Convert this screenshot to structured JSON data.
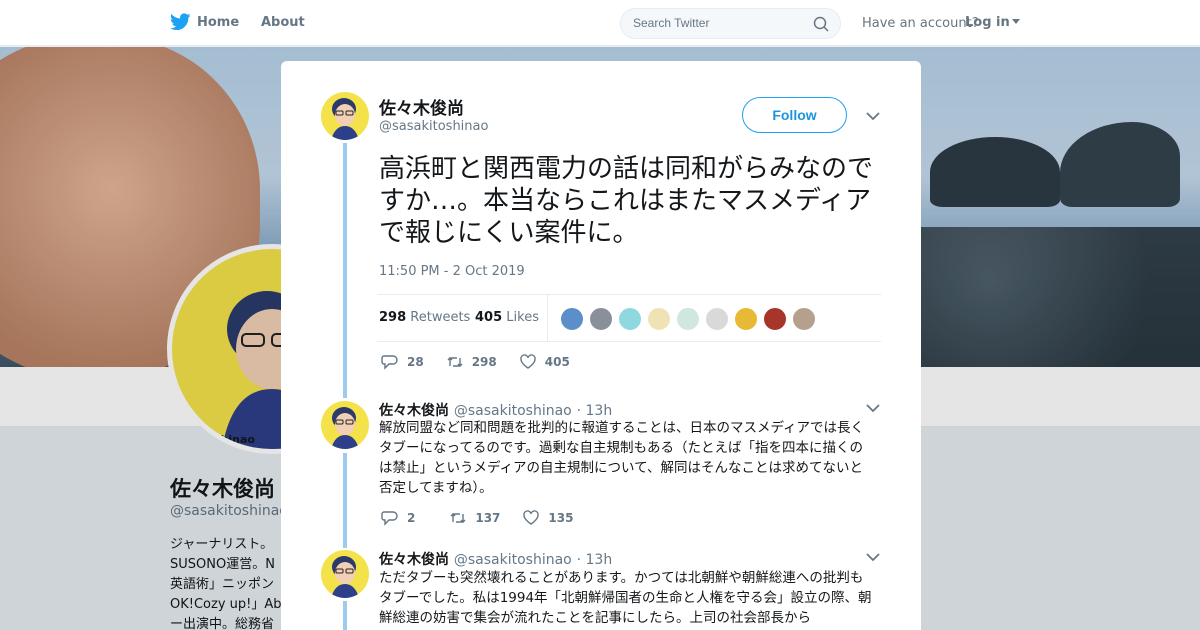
{
  "nav": {
    "home": "Home",
    "about": "About",
    "search_placeholder": "Search Twitter",
    "have_account": "Have an account?",
    "login": "Log in"
  },
  "profile": {
    "name": "佐々木俊尚",
    "handle": "@sasakitoshinao",
    "avatar_handle_overlay": "shinao",
    "bio_lines": [
      "ジャーナリスト。",
      "SUSONO運営。N",
      "英語術」ニッポン",
      "OK!Cozy up!」Ab",
      "ー出演中。総務省"
    ]
  },
  "tweet": {
    "name": "佐々木俊尚",
    "handle": "@sasakitoshinao",
    "follow": "Follow",
    "text": "高浜町と関西電力の話は同和がらみなのですか…。本当ならこれはまたマスメディアで報じにくい案件に。",
    "timestamp": "11:50 PM - 2 Oct 2019",
    "retweets_count": "298",
    "retweets_label": "Retweets",
    "likes_count": "405",
    "likes_label": "Likes",
    "replies": "28",
    "rts": "298",
    "likes": "405"
  },
  "replies": [
    {
      "name": "佐々木俊尚",
      "handle": "@sasakitoshinao",
      "time": "· 13h",
      "text": "解放同盟など同和問題を批判的に報道することは、日本のマスメディアでは長くタブーになってるのです。過剰な自主規制もある（たとえば「指を四本に描くのは禁止」というメディアの自主規制について、解同はそんなことは求めてないと否定してますね）。",
      "reply_count": "2",
      "retweet_count": "137",
      "like_count": "135"
    },
    {
      "name": "佐々木俊尚",
      "handle": "@sasakitoshinao",
      "time": "· 13h",
      "text": "ただタブーも突然壊れることがあります。かつては北朝鮮や朝鮮総連への批判もタブーでした。私は1994年「北朝鮮帰国者の生命と人権を守る会」設立の際、朝鮮総連の妨害で集会が流れたことを記事にしたら。上司の社会部長から"
    }
  ],
  "colors": {
    "accent": "#1da1f2",
    "thread_line": "#9ccbed",
    "avatar_bg": "#f4e24a"
  }
}
